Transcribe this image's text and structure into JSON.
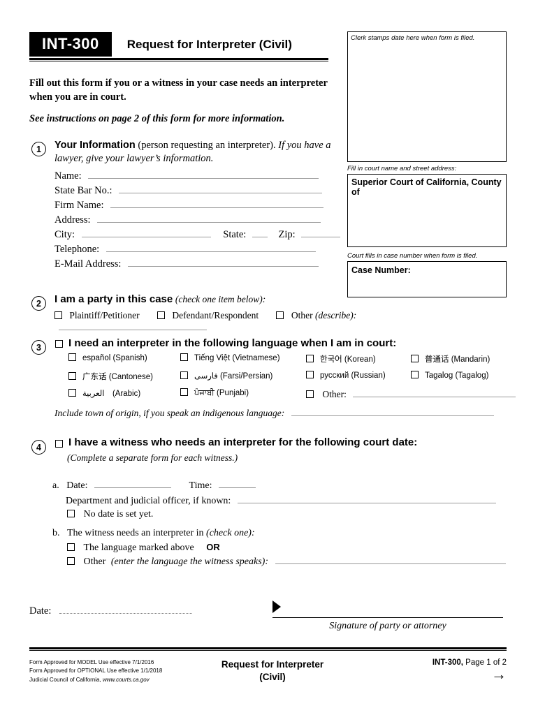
{
  "header": {
    "form_number": "INT-300",
    "title": "Request for Interpreter (Civil)",
    "lead": "Fill out this form if you or a witness in your case needs an interpreter when you are in court.",
    "see_instructions": "See instructions on page 2 of this form for more information."
  },
  "right_column": {
    "stamp_caption": "Clerk stamps date here when form is filed.",
    "court_caption": "Fill in court name and street address:",
    "court_heading": "Superior Court of California, County of",
    "case_caption": "Court fills in case number when form is filed.",
    "case_heading": "Case Number:"
  },
  "section1": {
    "number": "1",
    "title": "Your Information",
    "paren": "(person requesting an interpreter).",
    "italic": "If you have a lawyer, give your lawyer’s information.",
    "fields": [
      {
        "label": "Name:"
      },
      {
        "label": "State Bar No.:"
      },
      {
        "label": "Firm Name:"
      },
      {
        "label": "Address:"
      },
      {
        "label": "City:"
      },
      {
        "label": "State:"
      },
      {
        "label": "Zip:"
      },
      {
        "label": "Telephone:"
      },
      {
        "label": "E-Mail Address:"
      }
    ]
  },
  "section2": {
    "number": "2",
    "title": "I am a party in this case",
    "hint": "(check one item below):",
    "options": [
      {
        "label": "Plaintiff/Petitioner"
      },
      {
        "label": "Defendant/Respondent"
      },
      {
        "label": "Other",
        "hint": "(describe):"
      }
    ]
  },
  "section3": {
    "number": "3",
    "title": "I need an interpreter in the following language when I am in court:",
    "languages": [
      {
        "label": "español (Spanish)"
      },
      {
        "label": "Tiếng Việt (Vietnamese)"
      },
      {
        "label": "한국어 (Korean)"
      },
      {
        "label": "普通话 (Mandarin)"
      },
      {
        "label": "广东话 (Cantonese)"
      },
      {
        "label": "فارسی (Farsi/Persian)"
      },
      {
        "label": "русский (Russian)"
      },
      {
        "label": "Tagalog (Tagalog)"
      },
      {
        "label": "العربية (Arabic)"
      },
      {
        "label": "ਪੰਜਾਬੀ (Punjabi)"
      }
    ],
    "other_label": "Other:",
    "indigenous_note": "Include town of origin, if you speak an indigenous language:"
  },
  "section4": {
    "number": "4",
    "title": "I have a witness who needs an interpreter for the following court date:",
    "subtitle": "(Complete a separate form for each witness.)",
    "item_a": "a.",
    "date_label": "Date:",
    "time_label": "Time:",
    "department_label": "Department and judicial officer, if known:",
    "no_date_label": "No date is set yet.",
    "item_b": "b.",
    "b_text": "The witness needs an interpreter in",
    "b_hint": "(check one):",
    "b_option1": "The language marked above",
    "b_or": "OR",
    "b_option2": "Other",
    "b_option2_hint": "(enter the language the witness speaks):"
  },
  "signature": {
    "date_label": "Date:",
    "caption": "Signature of party or attorney"
  },
  "footer": {
    "approved_model": "Form Approved for MODEL Use effective 7/1/2016",
    "approved_optional": "Form Approved for OPTIONAL Use effective 1/1/2018",
    "council": "Judicial Council of California,",
    "council_url": "www.courts.ca.gov",
    "center_line1": "Request for Interpreter",
    "center_line2": "(Civil)",
    "form_number": "INT-300,",
    "page": "Page 1 of 2",
    "arrow": "→"
  }
}
